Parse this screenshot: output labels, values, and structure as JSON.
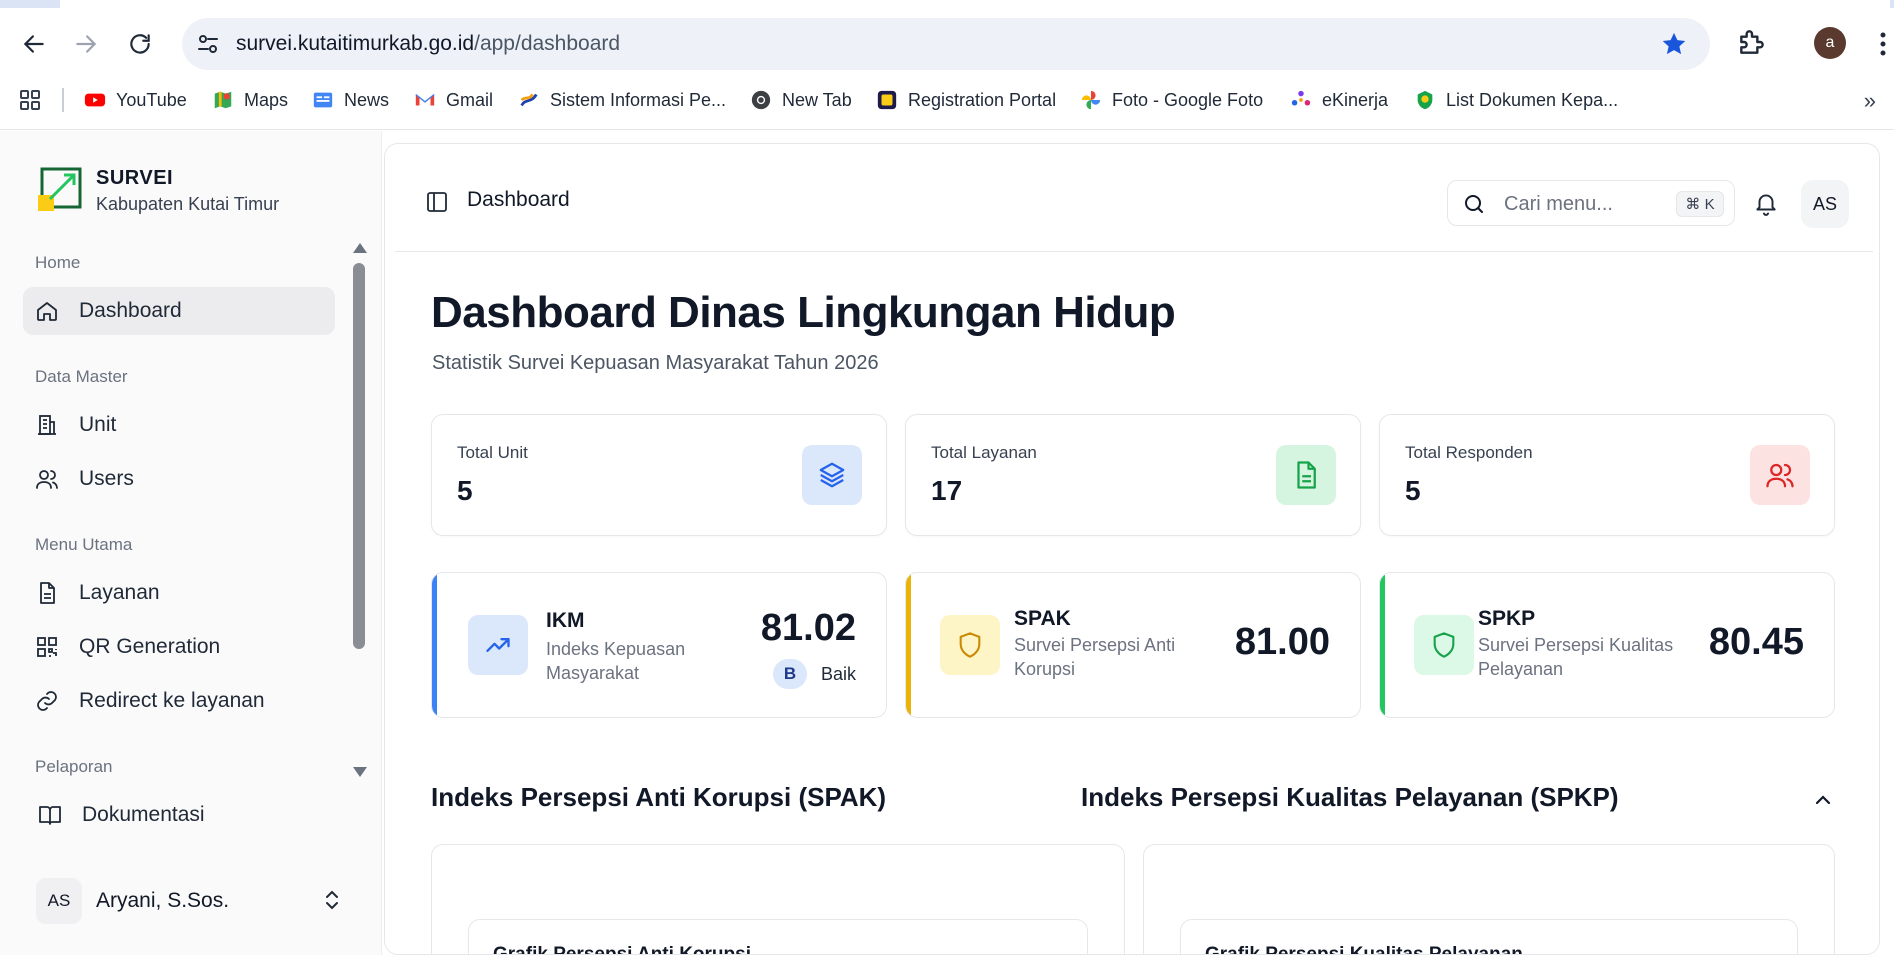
{
  "browser": {
    "url_host": "survei.kutaitimurkab.go.id",
    "url_path": "/app/dashboard",
    "profile_initial": "a",
    "bookmarks": [
      {
        "label": "YouTube",
        "icon": "youtube-icon"
      },
      {
        "label": "Maps",
        "icon": "maps-icon"
      },
      {
        "label": "News",
        "icon": "news-icon"
      },
      {
        "label": "Gmail",
        "icon": "gmail-icon"
      },
      {
        "label": "Sistem Informasi Pe...",
        "icon": "sip-icon"
      },
      {
        "label": "New Tab",
        "icon": "chrome-icon"
      },
      {
        "label": "Registration Portal",
        "icon": "portal-icon"
      },
      {
        "label": "Foto - Google Foto",
        "icon": "photos-icon"
      },
      {
        "label": "eKinerja",
        "icon": "ekinerja-icon"
      },
      {
        "label": "List Dokumen Kepa...",
        "icon": "kutim-icon"
      }
    ]
  },
  "sidebar": {
    "brand_title": "SURVEI",
    "brand_subtitle": "Kabupaten Kutai Timur",
    "sections": {
      "home": "Home",
      "data_master": "Data Master",
      "menu_utama": "Menu Utama",
      "pelaporan": "Pelaporan"
    },
    "items": {
      "dashboard": "Dashboard",
      "unit": "Unit",
      "users": "Users",
      "layanan": "Layanan",
      "qr": "QR Generation",
      "redirect": "Redirect ke layanan",
      "dokumentasi": "Dokumentasi"
    },
    "user": {
      "initials": "AS",
      "name": "Aryani, S.Sos."
    }
  },
  "topbar": {
    "title": "Dashboard",
    "search_placeholder": "Cari menu...",
    "shortcut": "⌘ K",
    "avatar_initials": "AS"
  },
  "page": {
    "title": "Dashboard Dinas Lingkungan Hidup",
    "subtitle": "Statistik Survei Kepuasan Masyarakat Tahun 2026"
  },
  "stats": [
    {
      "label": "Total Unit",
      "value": "5",
      "icon": "layers-icon",
      "bg": "#dbe7fb",
      "fg": "#2563eb"
    },
    {
      "label": "Total Layanan",
      "value": "17",
      "icon": "document-icon",
      "bg": "#d6f5e1",
      "fg": "#16a34a"
    },
    {
      "label": "Total Responden",
      "value": "5",
      "icon": "users-icon",
      "bg": "#fde2e2",
      "fg": "#dc2626"
    }
  ],
  "scores": {
    "ikm": {
      "code": "IKM",
      "desc": "Indeks Kepuasan Masyarakat",
      "score": "81.02",
      "grade": "B",
      "grade_text": "Baik",
      "accent": "#3b82f6"
    },
    "spak": {
      "code": "SPAK",
      "desc": "Survei Persepsi Anti Korupsi",
      "score": "81.00",
      "accent": "#eab308"
    },
    "spkp": {
      "code": "SPKP",
      "desc": "Survei Persepsi Kualitas Pelayanan",
      "score": "80.45",
      "accent": "#22c55e"
    }
  },
  "sections": {
    "spak_heading": "Indeks Persepsi Anti Korupsi (SPAK)",
    "spkp_heading": "Indeks Persepsi Kualitas Pelayanan (SPKP)",
    "spak_chart_title": "Grafik Persepsi Anti Korupsi",
    "spkp_chart_title": "Grafik Persepsi Kualitas Pelayanan"
  }
}
